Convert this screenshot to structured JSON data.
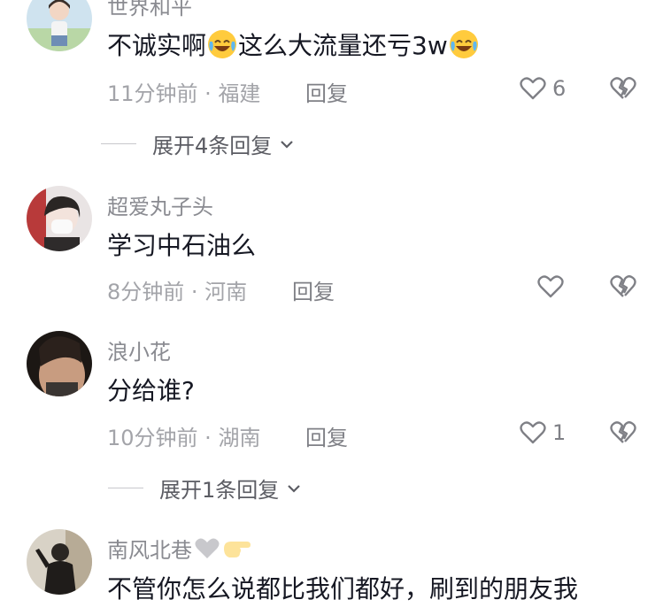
{
  "comments": [
    {
      "username": "世界和平",
      "text_parts": [
        "不诚实啊",
        "这么大流量还亏3w"
      ],
      "time": "11分钟前",
      "location": "福建",
      "reply_label": "回复",
      "like_count": "6",
      "expand_label": "展开4条回复"
    },
    {
      "username": "超爱丸子头",
      "text": "学习中石油么",
      "time": "8分钟前",
      "location": "河南",
      "reply_label": "回复",
      "like_count": ""
    },
    {
      "username": "浪小花",
      "text": "分给谁?",
      "time": "10分钟前",
      "location": "湖南",
      "reply_label": "回复",
      "like_count": "1",
      "expand_label": "展开1条回复"
    },
    {
      "username": "南风北巷",
      "text": "不管你怎么说都比我们都好，刷到的朋友我"
    }
  ],
  "separator": " · ",
  "icons": {
    "like": "heart-outline-icon",
    "dislike": "broken-heart-icon",
    "expand": "chevron-down-icon",
    "emoji": "tears-of-joy-emoji-icon"
  },
  "colors": {
    "text": "#161823",
    "muted": "#8a8b91",
    "icon": "#7f8086"
  }
}
